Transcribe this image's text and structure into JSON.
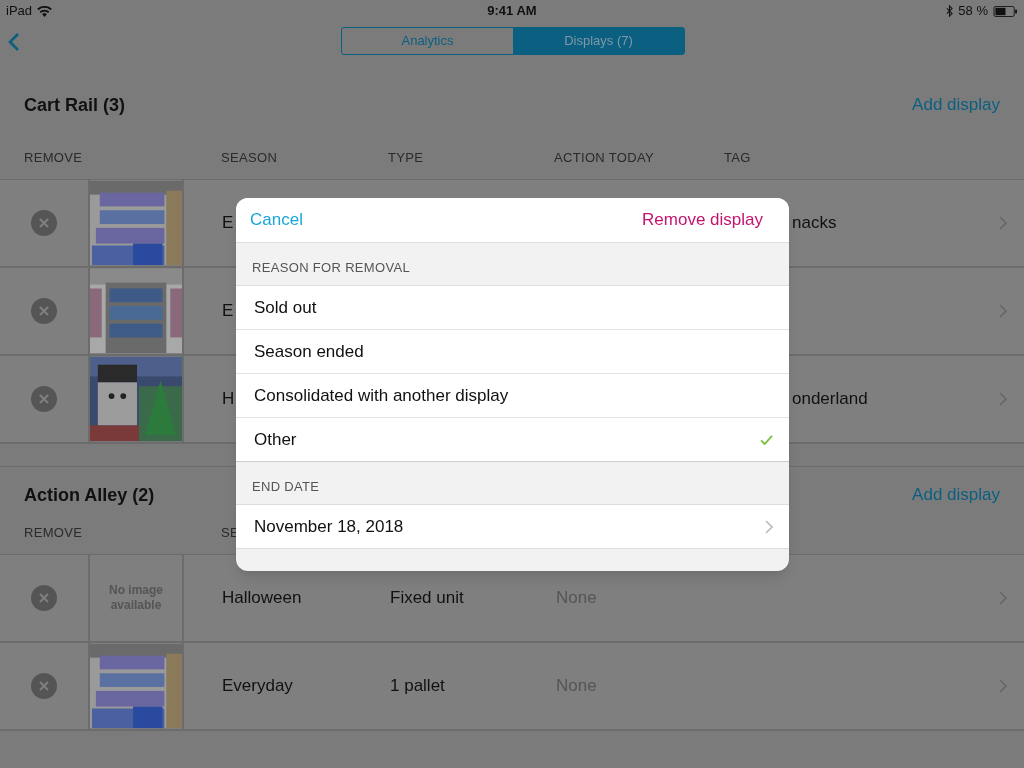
{
  "status_bar": {
    "device": "iPad",
    "time": "9:41 AM",
    "battery": "58 %"
  },
  "tabs": [
    {
      "label": "Analytics",
      "selected": false
    },
    {
      "label": "Displays (7)",
      "selected": true
    }
  ],
  "sections": [
    {
      "title": "Cart Rail (3)",
      "add": "Add display",
      "columns": [
        "REMOVE",
        "SEASON",
        "TYPE",
        "ACTION TODAY",
        "TAG"
      ],
      "rows": [
        {
          "season": "E",
          "tag": "nacks"
        },
        {
          "season": "E"
        },
        {
          "season": "H",
          "tag": "onderland"
        }
      ]
    },
    {
      "title": "Action Alley (2)",
      "add": "Add display",
      "columns": [
        "REMOVE",
        "SE"
      ],
      "rows": [
        {
          "image": {
            "kind": "placeholder",
            "text": "No image available"
          },
          "season": "Halloween",
          "type": "Fixed unit",
          "action": "None"
        },
        {
          "season": "Everyday",
          "type": "1 pallet",
          "action": "None"
        }
      ]
    }
  ],
  "modal": {
    "cancel": "Cancel",
    "confirm": "Remove display",
    "reason_header": "REASON FOR REMOVAL",
    "reasons": [
      {
        "label": "Sold out",
        "selected": false
      },
      {
        "label": "Season ended",
        "selected": false
      },
      {
        "label": "Consolidated with another display",
        "selected": false
      },
      {
        "label": "Other",
        "selected": true
      }
    ],
    "date_header": "END DATE",
    "date": "November 18, 2018"
  }
}
